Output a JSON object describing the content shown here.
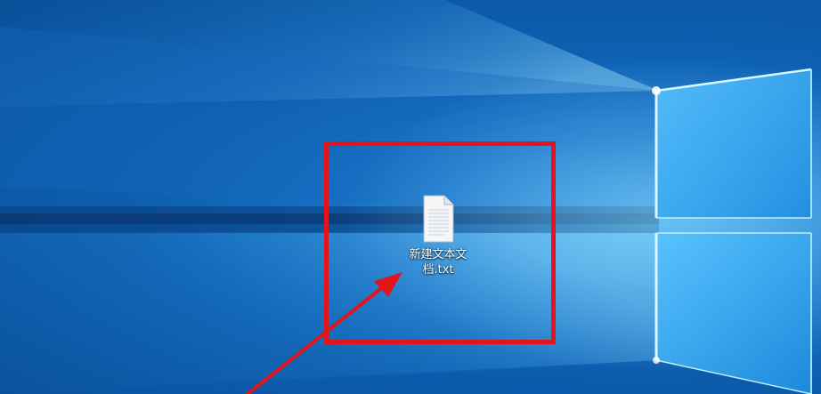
{
  "desktop": {
    "icons": [
      {
        "label": "新建文本文档.txt",
        "icon": "text-file-icon",
        "selected": false
      }
    ]
  },
  "annotation": {
    "highlight_color": "#e3141c",
    "arrow_color": "#e3141c"
  },
  "colors": {
    "wallpaper_primary": "#0d5fb0",
    "wallpaper_glow": "#3aa0e8",
    "window_light": "#7fd4ff"
  }
}
